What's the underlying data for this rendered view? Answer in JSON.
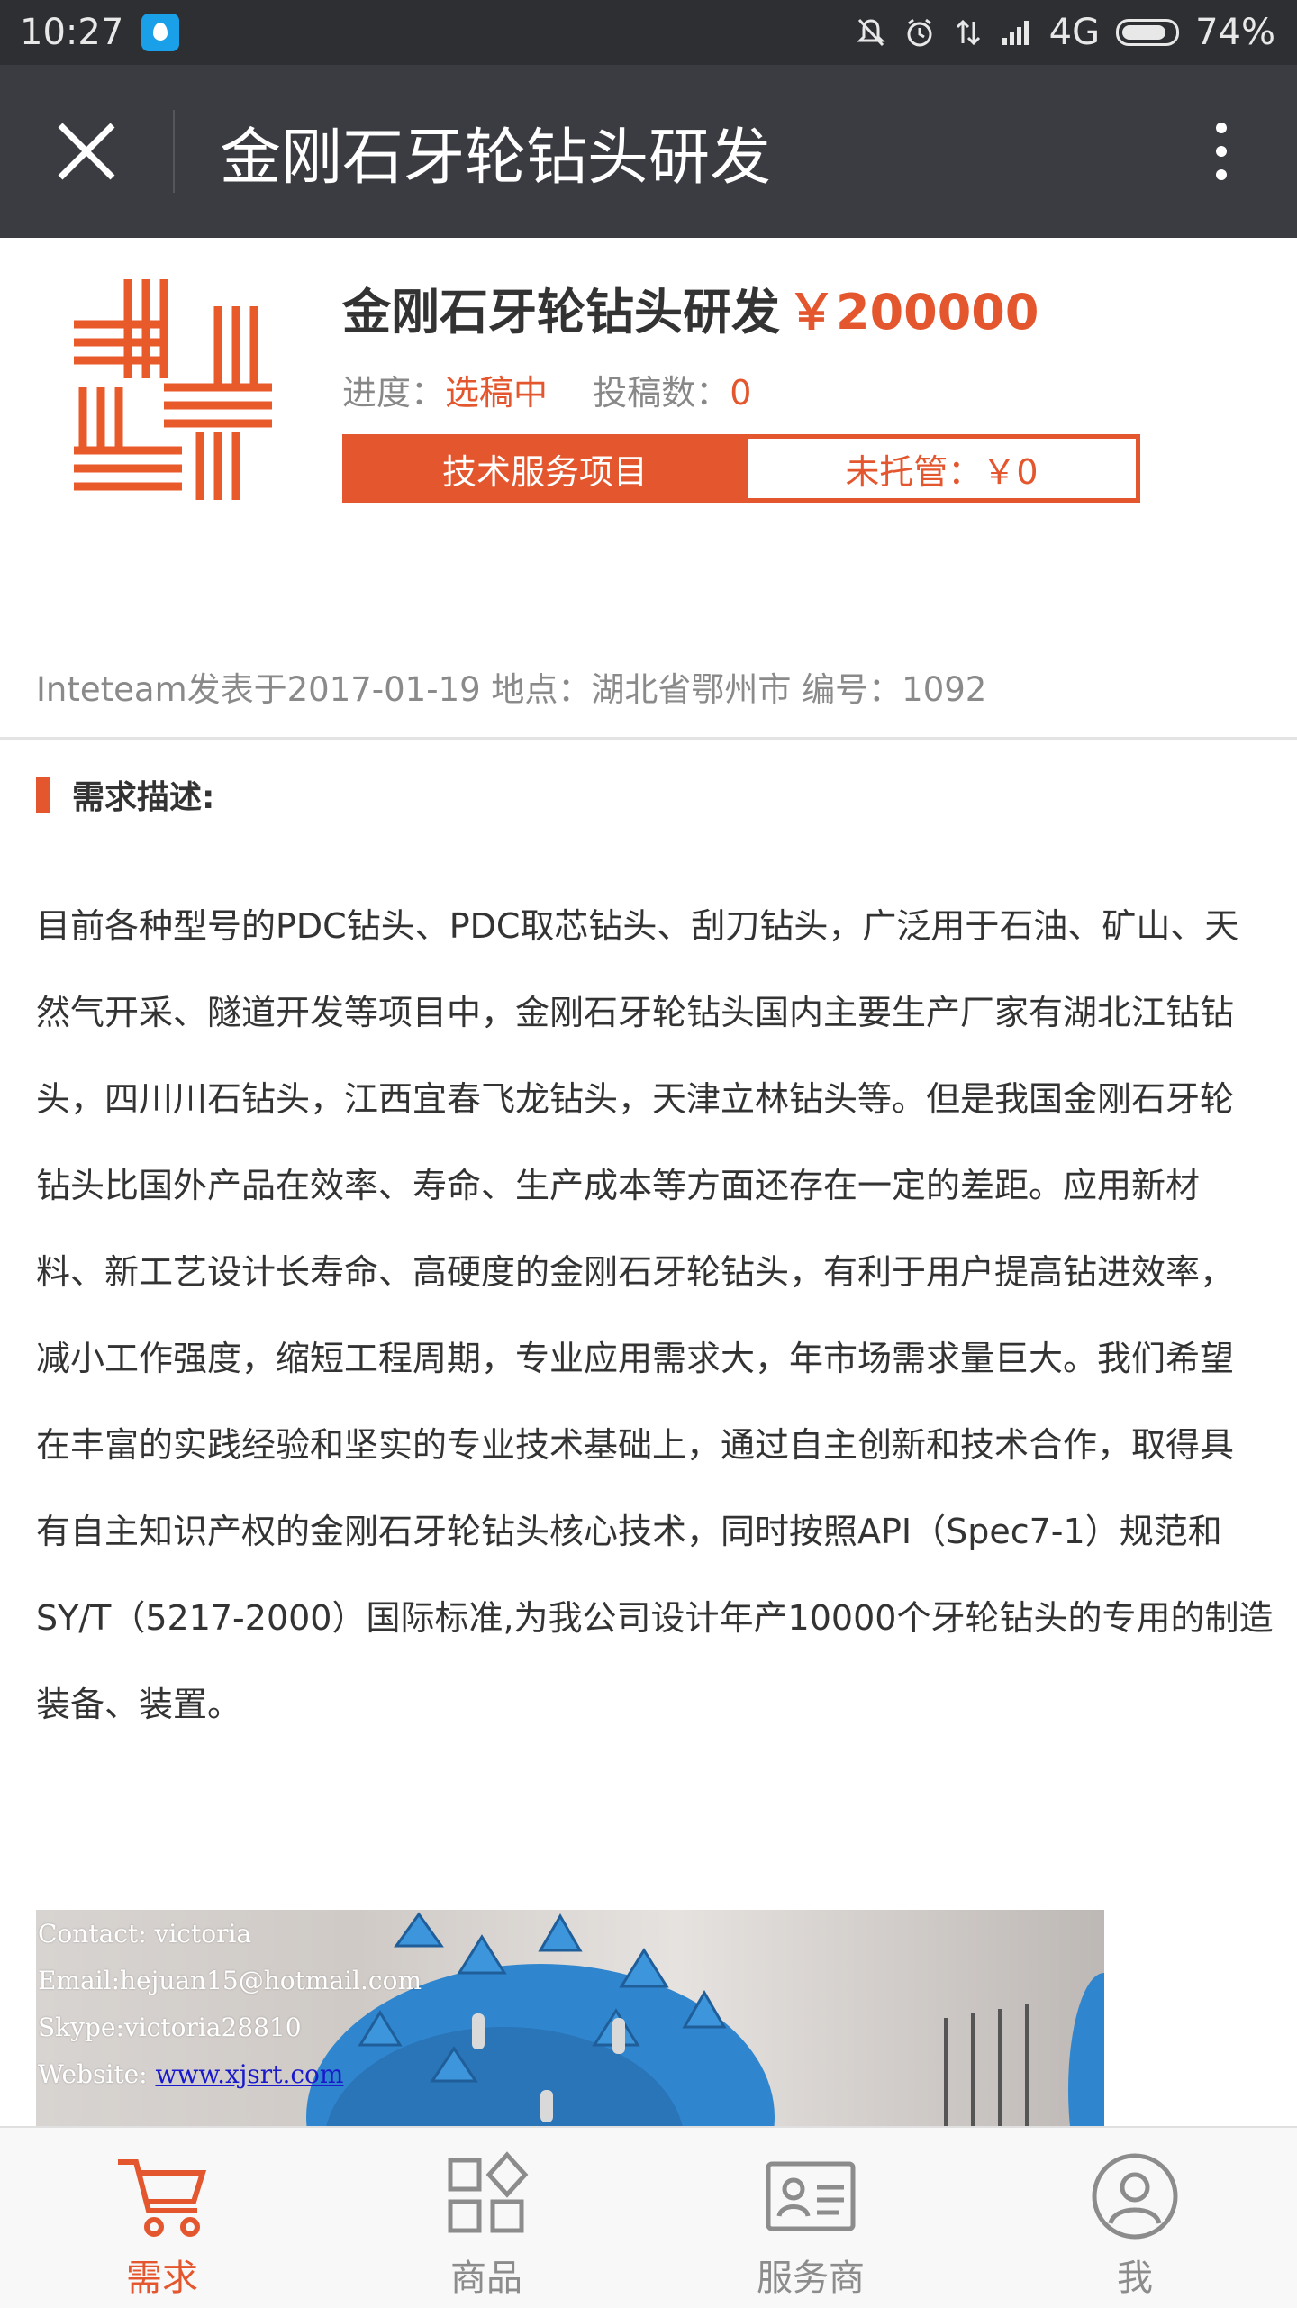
{
  "statusbar": {
    "time": "10:27",
    "network": "4G",
    "battery": "74%"
  },
  "header": {
    "title": "金刚石牙轮钻头研发"
  },
  "project": {
    "title": "金刚石牙轮钻头研发",
    "price": "￥200000",
    "progress_label": "进度：",
    "progress_value": "选稿中",
    "submissions_label": "投稿数：",
    "submissions_value": "0",
    "tag_type": "技术服务项目",
    "tag_escrow": "未托管：￥0",
    "info": "Inteteam发表于2017-01-19  地点：湖北省鄂州市  编号：1092"
  },
  "section": {
    "title": "需求描述:"
  },
  "description": "目前各种型号的PDC钻头、PDC取芯钻头、刮刀钻头，广泛用于石油、矿山、天\n然气开采、隧道开发等项目中，金刚石牙轮钻头国内主要生产厂家有湖北江钻钻\n头，四川川石钻头，江西宜春飞龙钻头，天津立林钻头等。但是我国金刚石牙轮\n钻头比国外产品在效率、寿命、生产成本等方面还存在一定的差距。应用新材\n料、新工艺设计长寿命、高硬度的金刚石牙轮钻头，有利于用户提高钻进效率，\n减小工作强度，缩短工程周期，专业应用需求大，年市场需求量巨大。我们希望\n在丰富的实践经验和坚实的专业技术基础上，通过自主创新和技术合作，取得具\n有自主知识产权的金刚石牙轮钻头核心技术，同时按照API（Spec7-1）规范和\nSY/T（5217-2000）国际标准,为我公司设计年产10000个牙轮钻头的专用的制造\n装备、装置。",
  "image_overlay": {
    "contact": "Contact: victoria",
    "email": "Email:hejuan15@hotmail.com",
    "skype": "Skype:victoria28810",
    "website_label": "Website: ",
    "website": "www.xjsrt.com"
  },
  "bottom_nav": {
    "items": [
      {
        "label": "需求",
        "icon": "cart-icon",
        "active": true
      },
      {
        "label": "商品",
        "icon": "grid-icon",
        "active": false
      },
      {
        "label": "服务商",
        "icon": "id-card-icon",
        "active": false
      },
      {
        "label": "我",
        "icon": "user-icon",
        "active": false
      }
    ]
  },
  "colors": {
    "accent": "#e4572e",
    "titlebar": "#3b3c41",
    "statusbar": "#2e2f33"
  }
}
